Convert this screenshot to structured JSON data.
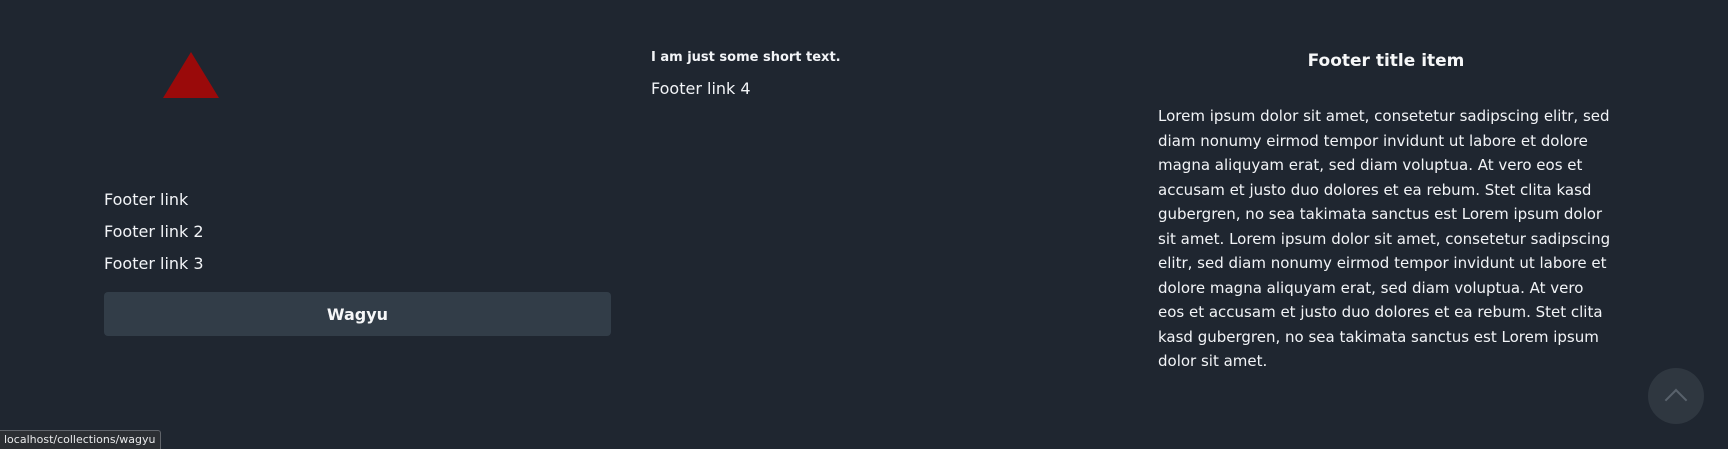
{
  "footer": {
    "logo_icon": "triangle-logo-icon",
    "links": [
      "Footer link",
      "Footer link 2",
      "Footer link 3"
    ],
    "cta_label": "Wagyu",
    "short_text": "I am just some short text.",
    "link_4": "Footer link 4",
    "title": "Footer title item",
    "paragraph": "Lorem ipsum dolor sit amet, consetetur sadipscing elitr, sed diam nonumy eirmod tempor invidunt ut labore et dolore magna aliquyam erat, sed diam voluptua. At vero eos et accusam et justo duo dolores et ea rebum. Stet clita kasd gubergren, no sea takimata sanctus est Lorem ipsum dolor sit amet. Lorem ipsum dolor sit amet, consetetur sadipscing elitr, sed diam nonumy eirmod tempor invidunt ut labore et dolore magna aliquyam erat, sed diam voluptua. At vero eos et accusam et justo duo dolores et ea rebum. Stet clita kasd gubergren, no sea takimata sanctus est Lorem ipsum dolor sit amet."
  },
  "back_to_top": {
    "icon": "chevron-up-icon"
  },
  "status_bar": {
    "url": "localhost/collections/wagyu"
  },
  "colors": {
    "background": "#1f2630",
    "logo": "#9a0a0a",
    "button": "#323d48",
    "text": "#f2f4f7"
  }
}
